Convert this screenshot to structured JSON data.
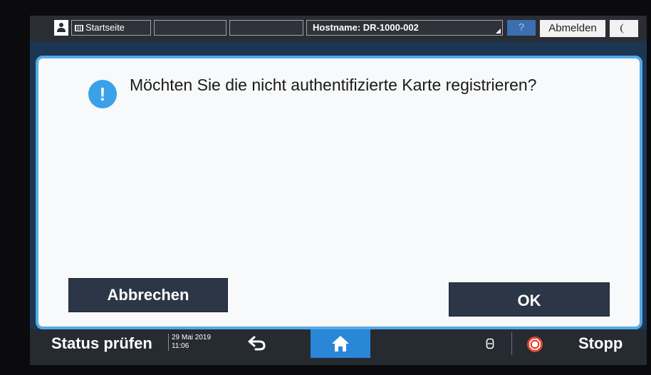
{
  "header": {
    "home_label": "Startseite",
    "hostname": "Hostname: DR-1000-002",
    "help_label": "?",
    "logout_label": "Abmelden"
  },
  "dialog": {
    "info_icon": "!",
    "message": "Möchten Sie die nicht authentifizierte Karte registrieren?",
    "cancel_label": "Abbrechen",
    "ok_label": "OK"
  },
  "footer": {
    "status_label": "Status prüfen",
    "date": "29 Mai 2019",
    "time": "11:06",
    "stop_label": "Stopp"
  },
  "colors": {
    "accent": "#2a87d8",
    "dialog_border": "#55a9e6",
    "stop_red": "#e0442e"
  },
  "icons": [
    "user-icon",
    "home-grid-icon",
    "moon-icon",
    "info-icon",
    "back-arrow-icon",
    "home-icon",
    "counter-icon",
    "stop-icon"
  ]
}
